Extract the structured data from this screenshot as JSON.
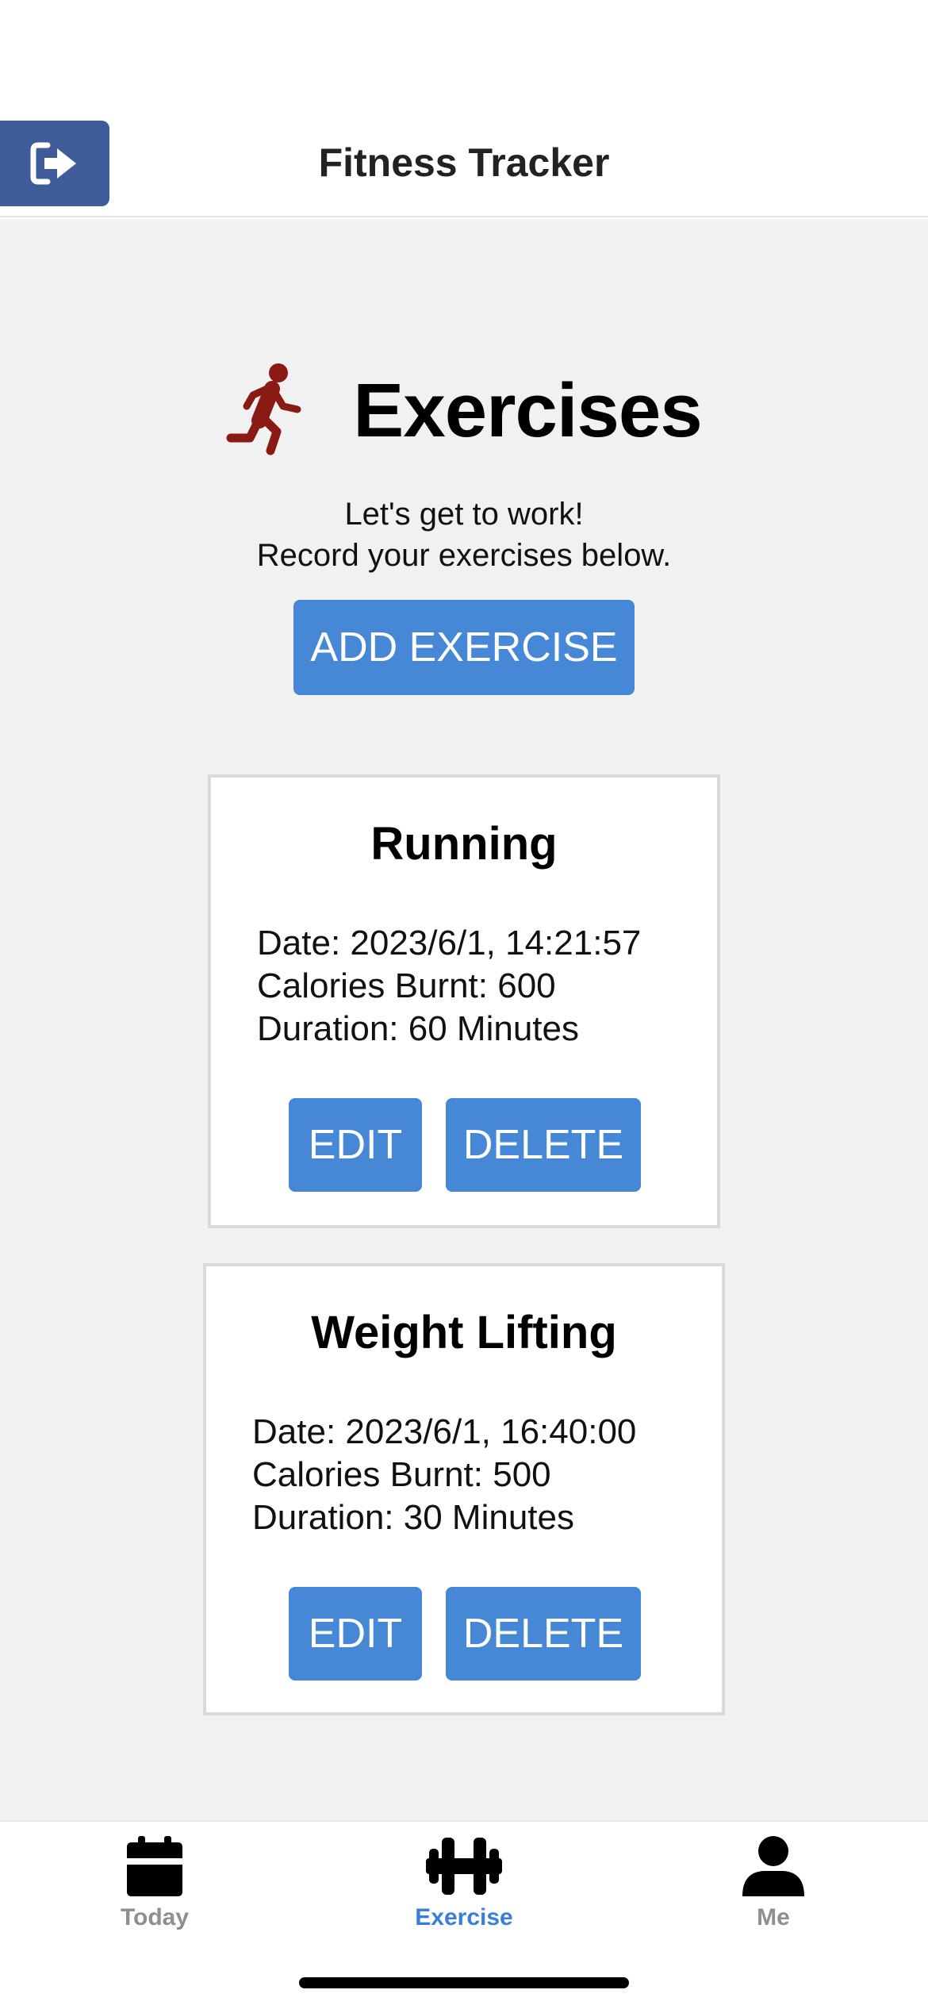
{
  "header": {
    "title": "Fitness Tracker",
    "logout_icon": "sign-out-icon",
    "button_color": "#3f5b9a"
  },
  "main": {
    "heading": "Exercises",
    "heading_icon": "running-person-icon",
    "heading_icon_color": "#8a1a14",
    "subtitle_line1": "Let's get to work!",
    "subtitle_line2": "Record your exercises below.",
    "add_button_label": "ADD EXERCISE",
    "accent_color": "#4788d6",
    "exercises": [
      {
        "name": "Running",
        "date": "Date: 2023/6/1, 14:21:57",
        "calories": "Calories Burnt: 600",
        "duration": "Duration: 60 Minutes",
        "edit_label": "EDIT",
        "delete_label": "DELETE"
      },
      {
        "name": "Weight Lifting",
        "date": "Date: 2023/6/1, 16:40:00",
        "calories": "Calories Burnt: 500",
        "duration": "Duration: 30 Minutes",
        "edit_label": "EDIT",
        "delete_label": "DELETE"
      }
    ]
  },
  "tabbar": {
    "tabs": [
      {
        "label": "Today",
        "icon": "calendar-icon",
        "active": false
      },
      {
        "label": "Exercise",
        "icon": "dumbbell-icon",
        "active": true
      },
      {
        "label": "Me",
        "icon": "user-icon",
        "active": false
      }
    ],
    "active_color": "#3b7dd8",
    "inactive_color": "#8e8e93"
  }
}
